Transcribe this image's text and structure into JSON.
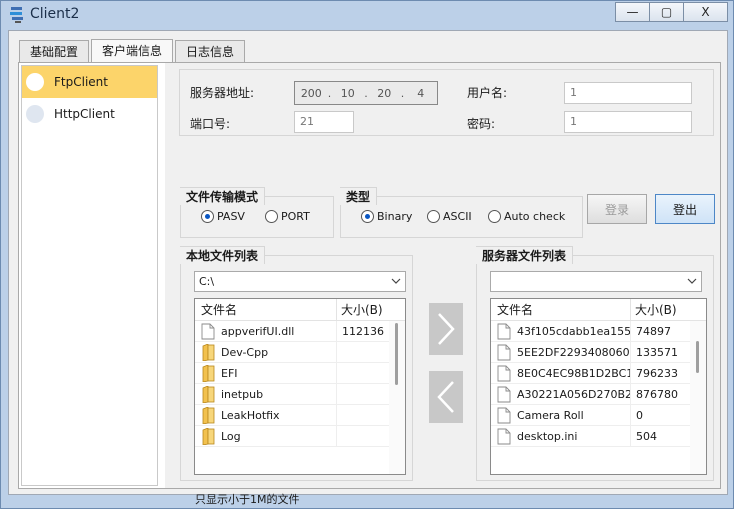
{
  "window": {
    "title": "Client2",
    "minimize_label": "—",
    "maximize_label": "▢",
    "close_label": "X"
  },
  "tabs": [
    {
      "label": "基础配置",
      "active": false
    },
    {
      "label": "客户端信息",
      "active": true
    },
    {
      "label": "日志信息",
      "active": false
    }
  ],
  "sidebar": {
    "items": [
      {
        "label": "FtpClient",
        "selected": true
      },
      {
        "label": "HttpClient",
        "selected": false
      }
    ]
  },
  "server": {
    "address_label": "服务器地址:",
    "ip": [
      "200",
      "10",
      "20",
      "4"
    ],
    "port_label": "端口号:",
    "port_value": "21",
    "user_label": "用户名:",
    "user_value": "1",
    "password_label": "密码:",
    "password_value": "1"
  },
  "transfer_mode": {
    "title": "文件传输模式",
    "options": [
      {
        "label": "PASV",
        "checked": true
      },
      {
        "label": "PORT",
        "checked": false
      }
    ]
  },
  "type": {
    "title": "类型",
    "options": [
      {
        "label": "Binary",
        "checked": true
      },
      {
        "label": "ASCII",
        "checked": false
      },
      {
        "label": "Auto check",
        "checked": false
      }
    ]
  },
  "buttons": {
    "login": "登录",
    "logout": "登出"
  },
  "local": {
    "title": "本地文件列表",
    "path": "C:\\",
    "col_name": "文件名",
    "col_size": "大小(B)",
    "rows": [
      {
        "name": "appverifUI.dll",
        "size": "112136",
        "kind": "file"
      },
      {
        "name": "Dev-Cpp",
        "size": "",
        "kind": "folder"
      },
      {
        "name": "EFI",
        "size": "",
        "kind": "folder"
      },
      {
        "name": "inetpub",
        "size": "",
        "kind": "folder"
      },
      {
        "name": "LeakHotfix",
        "size": "",
        "kind": "folder"
      },
      {
        "name": "Log",
        "size": "",
        "kind": "folder"
      }
    ]
  },
  "remote": {
    "title": "服务器文件列表",
    "path": "",
    "col_name": "文件名",
    "col_size": "大小(B)",
    "rows": [
      {
        "name": "43f105cdabb1ea155...",
        "size": "74897",
        "kind": "file"
      },
      {
        "name": "5EE2DF2293408060...",
        "size": "133571",
        "kind": "file"
      },
      {
        "name": "8E0C4EC98B1D2BC1...",
        "size": "796233",
        "kind": "file"
      },
      {
        "name": "A30221A056D270B2...",
        "size": "876780",
        "kind": "file"
      },
      {
        "name": "Camera Roll",
        "size": "0",
        "kind": "file"
      },
      {
        "name": "desktop.ini",
        "size": "504",
        "kind": "file"
      }
    ]
  },
  "note": "只显示小于1M的文件",
  "icons": {
    "upload": "chevron-right-icon",
    "download": "chevron-left-icon"
  },
  "colors": {
    "selected_sidebar": "#fcd46a",
    "radio_checked": "#0a57c4",
    "folder": "#f2c14e"
  }
}
